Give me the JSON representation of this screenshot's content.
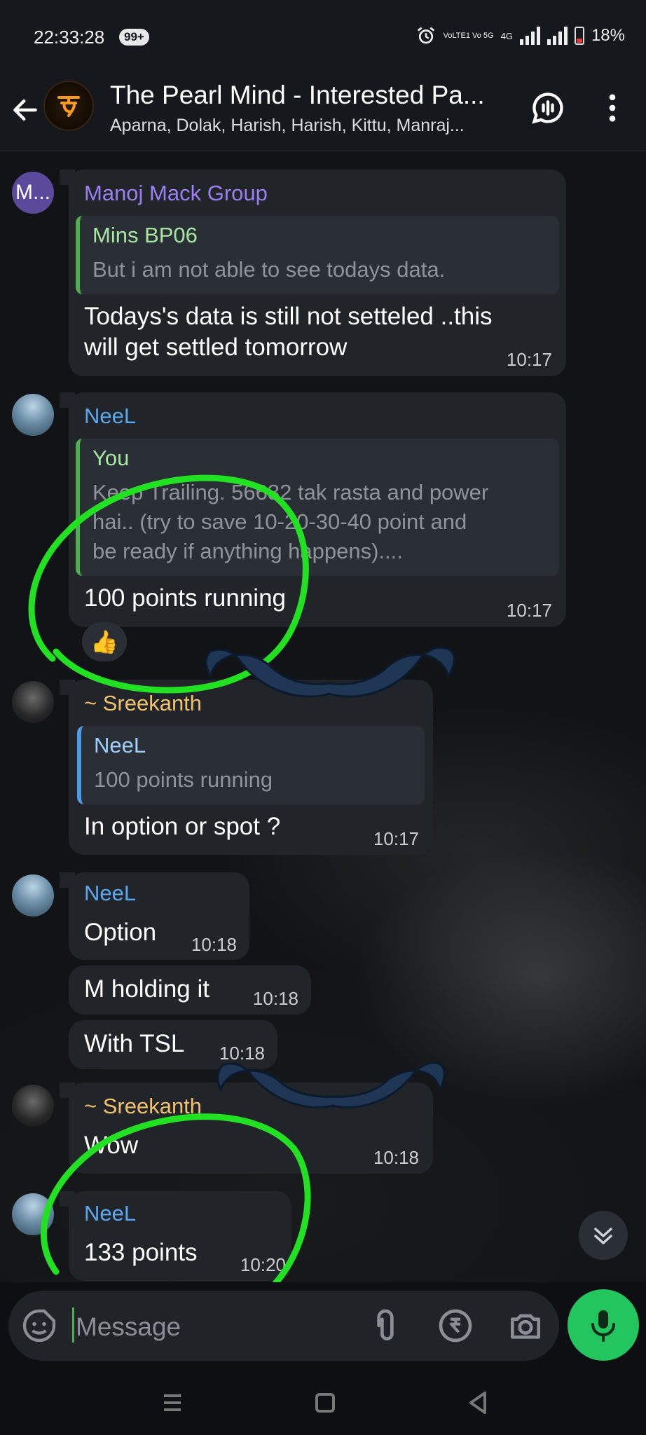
{
  "status_bar": {
    "time": "22:33:28",
    "badge": "99+",
    "net_label": "VoLTE1 Vo 5G",
    "lte": "4G",
    "battery": "18%"
  },
  "header": {
    "title": "The Pearl Mind - Interested Pa...",
    "members": "Aparna, Dolak, Harish, Harish, Kittu, Manraj..."
  },
  "messages": [
    {
      "avatar_text": "M...",
      "sender": "Manoj Mack Group",
      "reply_name": "Mins BP06",
      "reply_lines": [
        "But i am not able to see todays data."
      ],
      "text_lines": [
        "Todays's data is still not setteled ..this",
        "will get settled tomorrow"
      ],
      "time": "10:17"
    },
    {
      "sender": "NeeL",
      "reply_name": "You",
      "reply_lines": [
        "Keep Trailing. 56632 tak rasta and power",
        "hai.. (try to save 10-20-30-40 point and",
        "be ready if anything happens)...."
      ],
      "text_lines": [
        "100 points running"
      ],
      "time": "10:17",
      "reaction": "👍"
    },
    {
      "sender": "~ Sreekanth",
      "reply_name": "NeeL",
      "reply_lines": [
        "100 points running"
      ],
      "text_lines": [
        "In option or spot ?"
      ],
      "time": "10:17"
    },
    {
      "sender": "NeeL",
      "text": "Option",
      "time": "10:18"
    },
    {
      "text": "M holding it",
      "time": "10:18"
    },
    {
      "text": "With TSL",
      "time": "10:18"
    },
    {
      "sender": "~ Sreekanth",
      "text": "Wow",
      "time": "10:18"
    },
    {
      "sender": "NeeL",
      "text": "133 points",
      "time": "10:20"
    }
  ],
  "composer": {
    "placeholder": "Message"
  },
  "colors": {
    "bubble": "#212529",
    "manoj_name": "#9b7ff0",
    "neel_name": "#5aa9f0",
    "sreekanth_name": "#f2c26b",
    "reply_green": "#4caf50",
    "reply_blue": "#4d9be6",
    "reply_name_green": "#a8e6a3",
    "reply_name_blue": "#9fd0ff",
    "annotation_green": "#22e022",
    "mic_green": "#22c55e"
  }
}
